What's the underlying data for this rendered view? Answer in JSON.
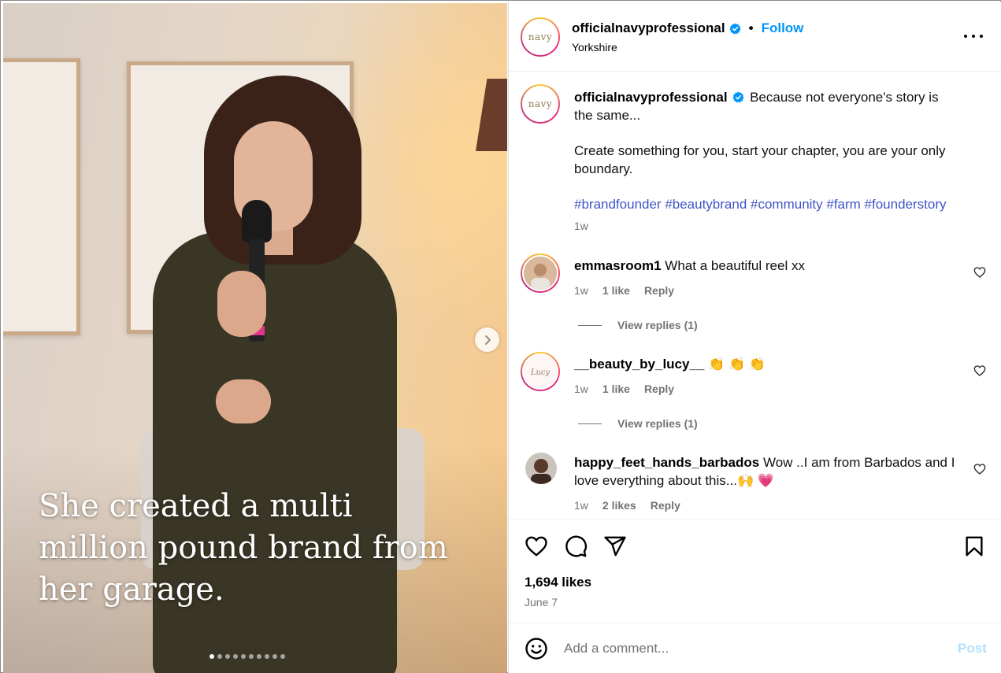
{
  "media": {
    "caption": "She created a multi million pound brand from her garage.",
    "slide_count": 10,
    "active_slide": 1
  },
  "header": {
    "username": "officialnavyprofessional",
    "follow_label": "Follow",
    "separator": "•",
    "location": "Yorkshire",
    "avatar_logo": "navy"
  },
  "post": {
    "username": "officialnavyprofessional",
    "caption_line1": "Because not everyone's story is the same...",
    "caption_line2": "Create something for you, start your chapter, you are your only boundary.",
    "hashtags": "#brandfounder #beautybrand #community #farm #founderstory",
    "time": "1w"
  },
  "comments": [
    {
      "username": "emmasroom1",
      "text": "What a beautiful reel xx",
      "time": "1w",
      "likes": "1 like",
      "reply_label": "Reply",
      "view_replies": "View replies (1)"
    },
    {
      "username": "__beauty_by_lucy__",
      "text": "👏 👏 👏",
      "time": "1w",
      "likes": "1 like",
      "reply_label": "Reply",
      "view_replies": "View replies (1)"
    },
    {
      "username": "happy_feet_hands_barbados",
      "text": "Wow ..I am from Barbados and I love everything about this...🙌 💗",
      "time": "1w",
      "likes": "2 likes",
      "reply_label": "Reply"
    }
  ],
  "actions": {
    "likes": "1,694 likes",
    "date": "June 7"
  },
  "add_comment": {
    "placeholder": "Add a comment...",
    "post_label": "Post"
  },
  "colors": {
    "link_blue": "#0095f6",
    "hashtag_blue": "#3f55c9",
    "muted": "#737373",
    "post_disabled": "#b2dffc"
  }
}
